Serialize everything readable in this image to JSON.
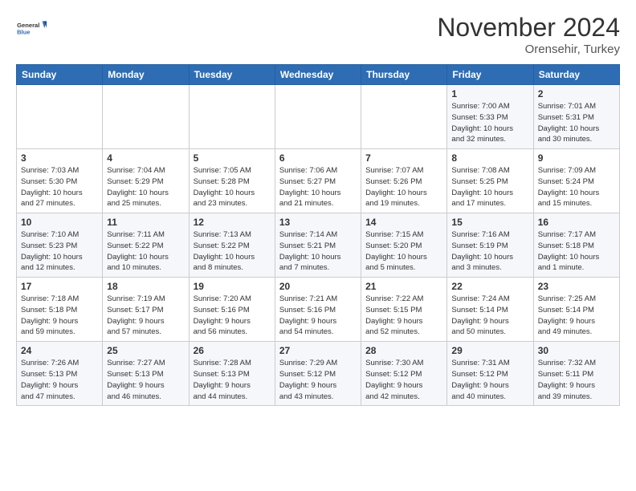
{
  "header": {
    "logo_general": "General",
    "logo_blue": "Blue",
    "month": "November 2024",
    "location": "Orensehir, Turkey"
  },
  "weekdays": [
    "Sunday",
    "Monday",
    "Tuesday",
    "Wednesday",
    "Thursday",
    "Friday",
    "Saturday"
  ],
  "rows": [
    [
      {
        "day": "",
        "info": ""
      },
      {
        "day": "",
        "info": ""
      },
      {
        "day": "",
        "info": ""
      },
      {
        "day": "",
        "info": ""
      },
      {
        "day": "",
        "info": ""
      },
      {
        "day": "1",
        "info": "Sunrise: 7:00 AM\nSunset: 5:33 PM\nDaylight: 10 hours\nand 32 minutes."
      },
      {
        "day": "2",
        "info": "Sunrise: 7:01 AM\nSunset: 5:31 PM\nDaylight: 10 hours\nand 30 minutes."
      }
    ],
    [
      {
        "day": "3",
        "info": "Sunrise: 7:03 AM\nSunset: 5:30 PM\nDaylight: 10 hours\nand 27 minutes."
      },
      {
        "day": "4",
        "info": "Sunrise: 7:04 AM\nSunset: 5:29 PM\nDaylight: 10 hours\nand 25 minutes."
      },
      {
        "day": "5",
        "info": "Sunrise: 7:05 AM\nSunset: 5:28 PM\nDaylight: 10 hours\nand 23 minutes."
      },
      {
        "day": "6",
        "info": "Sunrise: 7:06 AM\nSunset: 5:27 PM\nDaylight: 10 hours\nand 21 minutes."
      },
      {
        "day": "7",
        "info": "Sunrise: 7:07 AM\nSunset: 5:26 PM\nDaylight: 10 hours\nand 19 minutes."
      },
      {
        "day": "8",
        "info": "Sunrise: 7:08 AM\nSunset: 5:25 PM\nDaylight: 10 hours\nand 17 minutes."
      },
      {
        "day": "9",
        "info": "Sunrise: 7:09 AM\nSunset: 5:24 PM\nDaylight: 10 hours\nand 15 minutes."
      }
    ],
    [
      {
        "day": "10",
        "info": "Sunrise: 7:10 AM\nSunset: 5:23 PM\nDaylight: 10 hours\nand 12 minutes."
      },
      {
        "day": "11",
        "info": "Sunrise: 7:11 AM\nSunset: 5:22 PM\nDaylight: 10 hours\nand 10 minutes."
      },
      {
        "day": "12",
        "info": "Sunrise: 7:13 AM\nSunset: 5:22 PM\nDaylight: 10 hours\nand 8 minutes."
      },
      {
        "day": "13",
        "info": "Sunrise: 7:14 AM\nSunset: 5:21 PM\nDaylight: 10 hours\nand 7 minutes."
      },
      {
        "day": "14",
        "info": "Sunrise: 7:15 AM\nSunset: 5:20 PM\nDaylight: 10 hours\nand 5 minutes."
      },
      {
        "day": "15",
        "info": "Sunrise: 7:16 AM\nSunset: 5:19 PM\nDaylight: 10 hours\nand 3 minutes."
      },
      {
        "day": "16",
        "info": "Sunrise: 7:17 AM\nSunset: 5:18 PM\nDaylight: 10 hours\nand 1 minute."
      }
    ],
    [
      {
        "day": "17",
        "info": "Sunrise: 7:18 AM\nSunset: 5:18 PM\nDaylight: 9 hours\nand 59 minutes."
      },
      {
        "day": "18",
        "info": "Sunrise: 7:19 AM\nSunset: 5:17 PM\nDaylight: 9 hours\nand 57 minutes."
      },
      {
        "day": "19",
        "info": "Sunrise: 7:20 AM\nSunset: 5:16 PM\nDaylight: 9 hours\nand 56 minutes."
      },
      {
        "day": "20",
        "info": "Sunrise: 7:21 AM\nSunset: 5:16 PM\nDaylight: 9 hours\nand 54 minutes."
      },
      {
        "day": "21",
        "info": "Sunrise: 7:22 AM\nSunset: 5:15 PM\nDaylight: 9 hours\nand 52 minutes."
      },
      {
        "day": "22",
        "info": "Sunrise: 7:24 AM\nSunset: 5:14 PM\nDaylight: 9 hours\nand 50 minutes."
      },
      {
        "day": "23",
        "info": "Sunrise: 7:25 AM\nSunset: 5:14 PM\nDaylight: 9 hours\nand 49 minutes."
      }
    ],
    [
      {
        "day": "24",
        "info": "Sunrise: 7:26 AM\nSunset: 5:13 PM\nDaylight: 9 hours\nand 47 minutes."
      },
      {
        "day": "25",
        "info": "Sunrise: 7:27 AM\nSunset: 5:13 PM\nDaylight: 9 hours\nand 46 minutes."
      },
      {
        "day": "26",
        "info": "Sunrise: 7:28 AM\nSunset: 5:13 PM\nDaylight: 9 hours\nand 44 minutes."
      },
      {
        "day": "27",
        "info": "Sunrise: 7:29 AM\nSunset: 5:12 PM\nDaylight: 9 hours\nand 43 minutes."
      },
      {
        "day": "28",
        "info": "Sunrise: 7:30 AM\nSunset: 5:12 PM\nDaylight: 9 hours\nand 42 minutes."
      },
      {
        "day": "29",
        "info": "Sunrise: 7:31 AM\nSunset: 5:12 PM\nDaylight: 9 hours\nand 40 minutes."
      },
      {
        "day": "30",
        "info": "Sunrise: 7:32 AM\nSunset: 5:11 PM\nDaylight: 9 hours\nand 39 minutes."
      }
    ]
  ]
}
